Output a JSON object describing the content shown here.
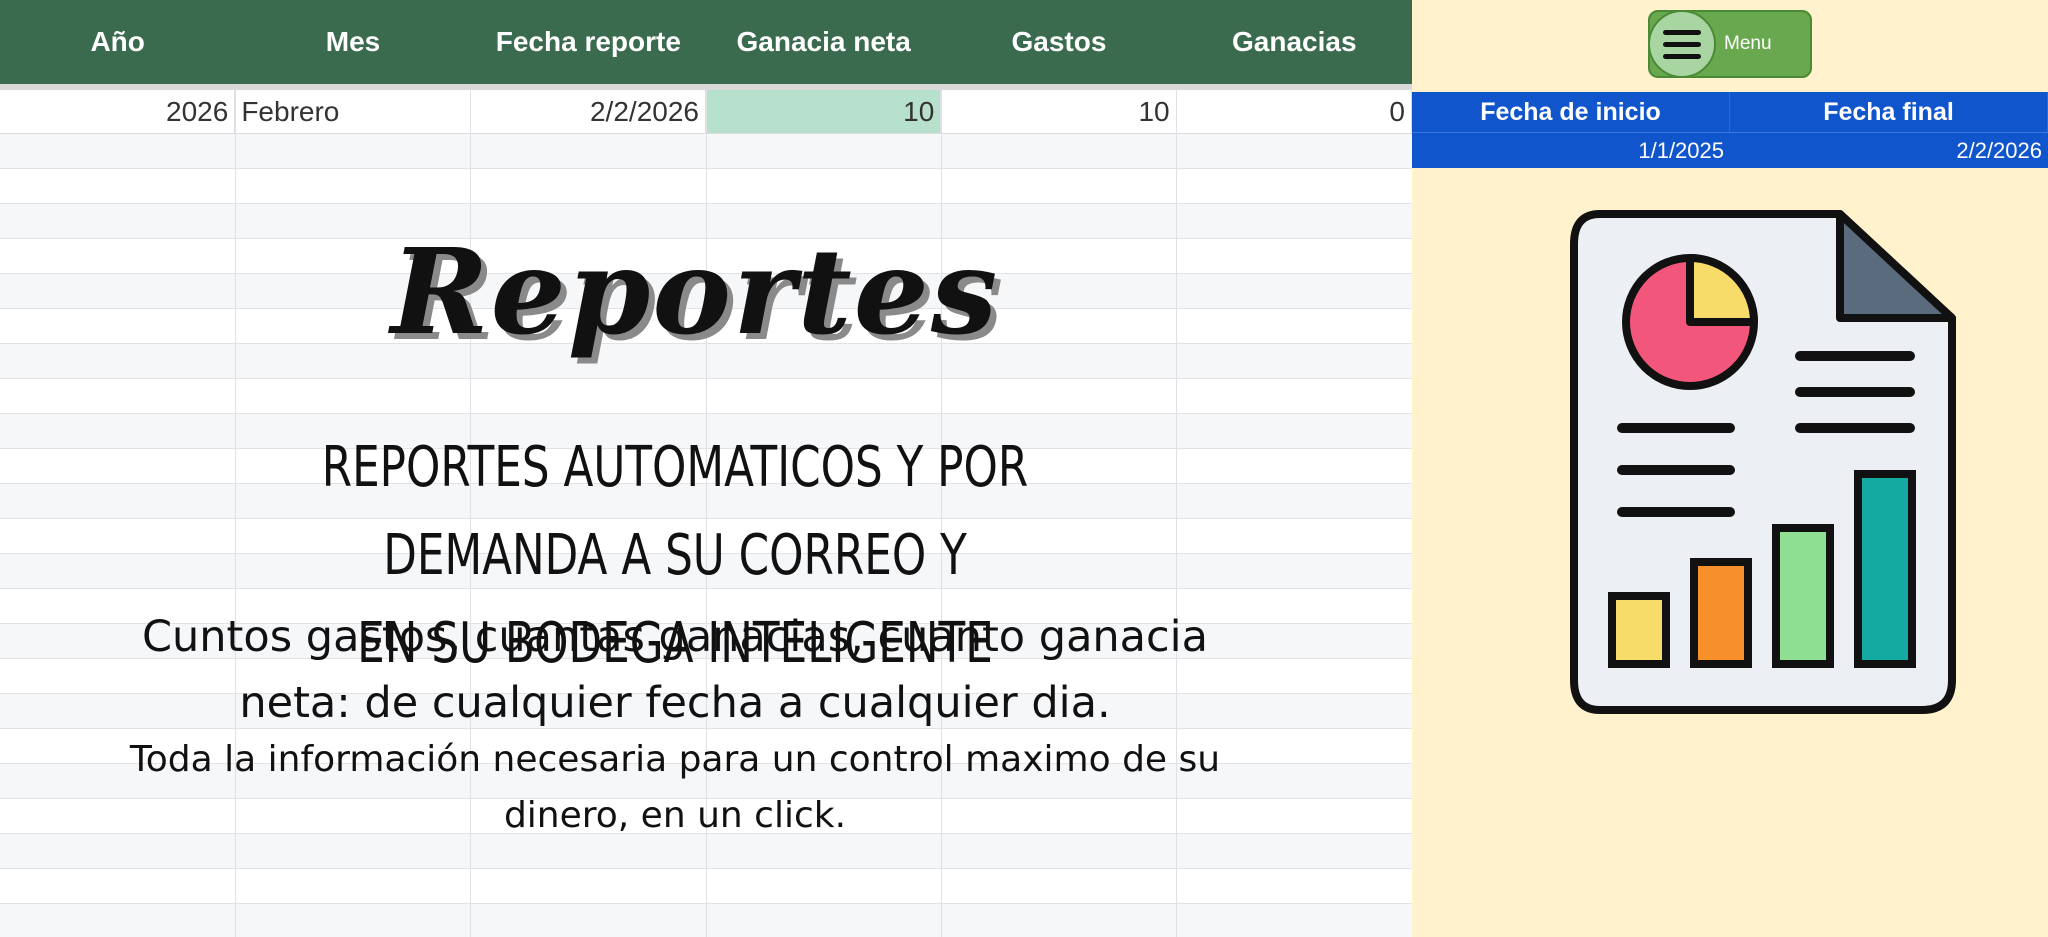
{
  "table": {
    "headers": [
      "Año",
      "Mes",
      "Fecha reporte",
      "Ganacia neta",
      "Gastos",
      "Ganacias"
    ],
    "row": {
      "year": "2026",
      "month": "Febrero",
      "report_date": "2/2/2026",
      "net_profit": "10",
      "expenses": "10",
      "earnings": "0"
    },
    "highlight_color": "#b7e1cd",
    "header_color": "#3b6b4f"
  },
  "hero": {
    "title": "Reportes",
    "subtitle_line1": "REPORTES AUTOMATICOS Y POR DEMANDA A SU CORREO Y",
    "subtitle_line2": "EN SU BODEGA INTELIGENTE",
    "desc1_line1": "Cuntos gastos, cuantas ganacias, cuanto ganacia",
    "desc1_line2": "neta: de cualquier fecha a cualquier dia.",
    "desc2_line1": "Toda la información necesaria para un control maximo de su",
    "desc2_line2": "dinero, en un click."
  },
  "sidebar": {
    "menu_label": "Menu",
    "menu_icon": "hamburger-icon",
    "date_headers": [
      "Fecha de inicio",
      "Fecha final"
    ],
    "start_date": "1/1/2025",
    "end_date": "2/2/2026",
    "panel_color": "#fff2cc",
    "date_header_color": "#1155cc",
    "illustration_icon": "report-document-icon"
  }
}
